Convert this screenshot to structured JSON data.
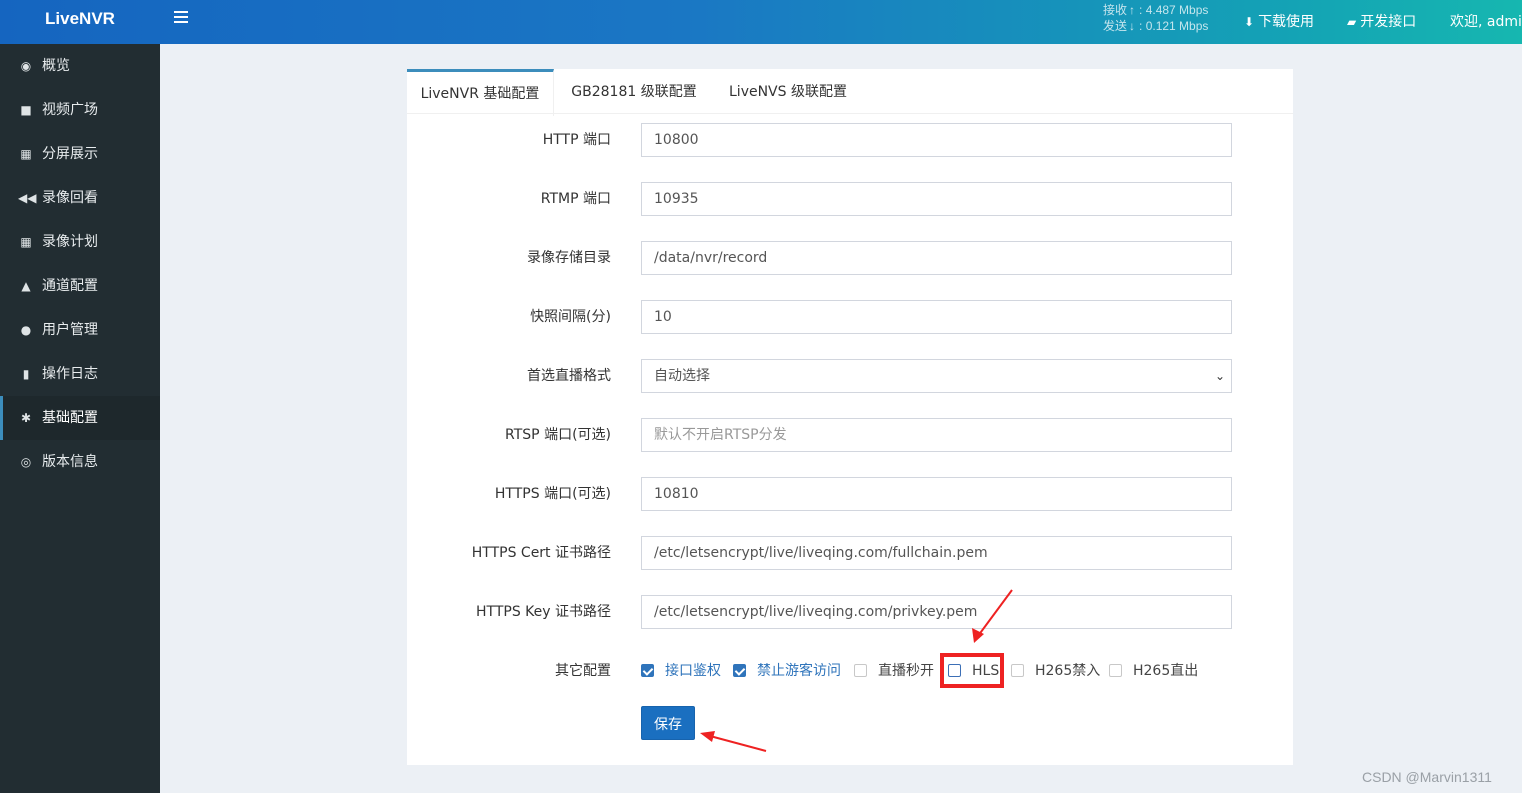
{
  "app": {
    "logo": "LiveNVR"
  },
  "header": {
    "rx_label": "接收",
    "rx_arrow": "↑",
    "rx_value": "4.487 Mbps",
    "tx_label": "发送",
    "tx_arrow": "↓",
    "tx_value": "0.121 Mbps",
    "download_label": "下载使用",
    "api_label": "开发接口",
    "welcome": "欢迎, admin"
  },
  "sidebar": {
    "items": [
      {
        "label": "概览",
        "icon": "dashboard-icon",
        "glyph": "◉"
      },
      {
        "label": "视频广场",
        "icon": "video-camera-icon",
        "glyph": "■"
      },
      {
        "label": "分屏展示",
        "icon": "grid-icon",
        "glyph": "▦"
      },
      {
        "label": "录像回看",
        "icon": "backward-icon",
        "glyph": "◀◀"
      },
      {
        "label": "录像计划",
        "icon": "calendar-icon",
        "glyph": "▦"
      },
      {
        "label": "通道配置",
        "icon": "road-icon",
        "glyph": "▲"
      },
      {
        "label": "用户管理",
        "icon": "users-icon",
        "glyph": "●"
      },
      {
        "label": "操作日志",
        "icon": "file-icon",
        "glyph": "▮"
      },
      {
        "label": "基础配置",
        "icon": "gears-icon",
        "glyph": "✱"
      },
      {
        "label": "版本信息",
        "icon": "lifebuoy-icon",
        "glyph": "◎"
      }
    ],
    "active_index": 8
  },
  "tabs": [
    {
      "label": "LiveNVR 基础配置"
    },
    {
      "label": "GB28181 级联配置"
    },
    {
      "label": "LiveNVS 级联配置"
    }
  ],
  "form": {
    "fields": [
      {
        "label": "HTTP 端口",
        "value": "10800"
      },
      {
        "label": "RTMP 端口",
        "value": "10935"
      },
      {
        "label": "录像存储目录",
        "value": "/data/nvr/record"
      },
      {
        "label": "快照间隔(分)",
        "value": "10"
      },
      {
        "label": "首选直播格式",
        "value": "自动选择"
      },
      {
        "label": "RTSP 端口(可选)",
        "placeholder": "默认不开启RTSP分发"
      },
      {
        "label": "HTTPS 端口(可选)",
        "value": "10810"
      },
      {
        "label": "HTTPS Cert 证书路径",
        "value": "/etc/letsencrypt/live/liveqing.com/fullchain.pem"
      },
      {
        "label": "HTTPS Key 证书路径",
        "value": "/etc/letsencrypt/live/liveqing.com/privkey.pem"
      }
    ],
    "other_label": "其它配置",
    "checkboxes": [
      {
        "label": "接口鉴权",
        "checked": true
      },
      {
        "label": "禁止游客访问",
        "checked": true
      },
      {
        "label": "直播秒开",
        "checked": false
      },
      {
        "label": "HLS",
        "checked": false
      },
      {
        "label": "H265禁入",
        "checked": false
      },
      {
        "label": "H265直出",
        "checked": false
      }
    ],
    "save_label": "保存"
  },
  "watermark": "CSDN @Marvin1311",
  "colors": {
    "accent": "#3c8dbc",
    "sidebar": "#222d32",
    "highlight": "#ee2222",
    "button": "#1a6fc0"
  }
}
